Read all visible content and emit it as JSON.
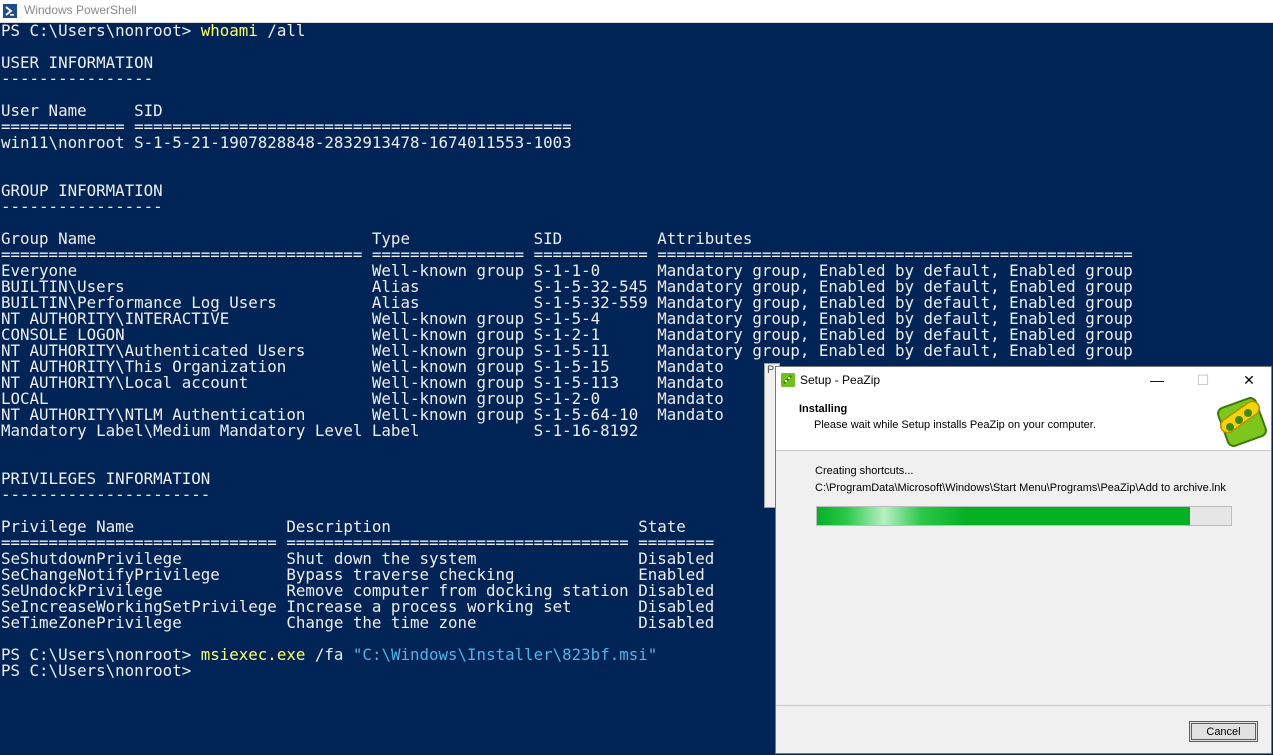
{
  "window": {
    "title": "Windows PowerShell",
    "icon": "powershell-icon"
  },
  "console": {
    "background": "#012456",
    "text_color": "#eeedf0",
    "command_color": "#ffff66",
    "string_color": "#4fb4e8",
    "prompt1": "PS C:\\Users\\nonroot> ",
    "cmd1": "whoami",
    "cmd1_args": " /all",
    "user_section": "USER INFORMATION",
    "user_section_rule": "----------------",
    "user_header": "User Name     SID",
    "user_header_rule": "============= ==============================================",
    "user_row": "win11\\nonroot S-1-5-21-1907828848-2832913478-1674011553-1003",
    "group_section": "GROUP INFORMATION",
    "group_section_rule": "-----------------",
    "group_header": "Group Name                             Type             SID          Attributes",
    "group_header_rule": "====================================== ================ ============ ==================================================",
    "group_rows": [
      "Everyone                               Well-known group S-1-1-0      Mandatory group, Enabled by default, Enabled group",
      "BUILTIN\\Users                          Alias            S-1-5-32-545 Mandatory group, Enabled by default, Enabled group",
      "BUILTIN\\Performance Log Users          Alias            S-1-5-32-559 Mandatory group, Enabled by default, Enabled group",
      "NT AUTHORITY\\INTERACTIVE               Well-known group S-1-5-4      Mandatory group, Enabled by default, Enabled group",
      "CONSOLE LOGON                          Well-known group S-1-2-1      Mandatory group, Enabled by default, Enabled group",
      "NT AUTHORITY\\Authenticated Users       Well-known group S-1-5-11     Mandatory group, Enabled by default, Enabled group",
      "NT AUTHORITY\\This Organization         Well-known group S-1-5-15     Mandato",
      "NT AUTHORITY\\Local account             Well-known group S-1-5-113    Mandato",
      "LOCAL                                  Well-known group S-1-2-0      Mandato",
      "NT AUTHORITY\\NTLM Authentication       Well-known group S-1-5-64-10  Mandato",
      "Mandatory Label\\Medium Mandatory Level Label            S-1-16-8192"
    ],
    "priv_section": "PRIVILEGES INFORMATION",
    "priv_section_rule": "----------------------",
    "priv_header": "Privilege Name                Description                          State",
    "priv_header_rule": "============================= ==================================== ========",
    "priv_rows": [
      "SeShutdownPrivilege           Shut down the system                 Disabled",
      "SeChangeNotifyPrivilege       Bypass traverse checking             Enabled",
      "SeUndockPrivilege             Remove computer from docking station Disabled",
      "SeIncreaseWorkingSetPrivilege Increase a process working set       Disabled",
      "SeTimeZonePrivilege           Change the time zone                 Disabled"
    ],
    "prompt2": "PS C:\\Users\\nonroot> ",
    "cmd2": "msiexec.exe",
    "cmd2_args": " /fa ",
    "cmd2_string": "\"C:\\Windows\\Installer\\823bf.msi\"",
    "prompt3": "PS C:\\Users\\nonroot>"
  },
  "ghost_dialog": {
    "letter": "P"
  },
  "setup": {
    "title": "Setup - PeaZip",
    "heading": "Installing",
    "subheading": "Please wait while Setup installs PeaZip on your computer.",
    "status": "Creating shortcuts...",
    "path": "C:\\ProgramData\\Microsoft\\Windows\\Start Menu\\Programs\\PeaZip\\Add to archive.lnk",
    "progress": 0.9,
    "progress_color": "#06b025",
    "cancel_label": "Cancel",
    "minimize_glyph": "—",
    "maximize_glyph": "☐",
    "close_glyph": "✕"
  }
}
